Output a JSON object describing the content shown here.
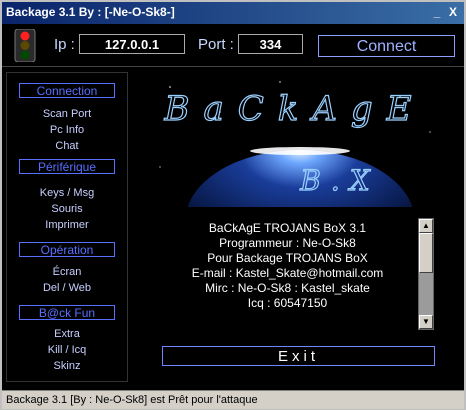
{
  "window": {
    "title": "Backage 3.1 By : [-Ne-O-Sk8-]",
    "minimize": "_",
    "close": "X"
  },
  "toolbar": {
    "ip_label": "Ip :",
    "ip_value": "127.0.0.1",
    "port_label": "Port :",
    "port_value": "334",
    "connect_label": "Connect"
  },
  "sidebar": {
    "sections": [
      {
        "title": "Connection",
        "items": [
          "Scan Port",
          "Pc Info",
          "Chat"
        ]
      },
      {
        "title": "Périférique",
        "items": [
          "Keys / Msg",
          "Souris",
          "Imprimer"
        ]
      },
      {
        "title": "Opération",
        "items": [
          "Écran",
          "Del / Web"
        ]
      },
      {
        "title": "B@ck Fun",
        "items": [
          "Extra",
          "Kill / Icq",
          "Skinz"
        ]
      }
    ]
  },
  "logo": {
    "top": "BaCkAgE",
    "bottom": "B.X"
  },
  "info_lines": [
    "BaCkAgE  TROJANS  BoX  3.1",
    "Programmeur : Ne-O-Sk8",
    "Pour Backage TROJANS BoX",
    "E-mail : Kastel_Skate@hotmail.com",
    "Mirc : Ne-O-Sk8 : Kastel_skate",
    "Icq : 60547150"
  ],
  "exit_label": "Exit",
  "status_text": "Backage 3.1 [By : Ne-O-Sk8]  est Prêt pour l'attaque",
  "colors": {
    "title_bar": "#0a246a",
    "accent": "#5870ff",
    "background": "#000000"
  }
}
